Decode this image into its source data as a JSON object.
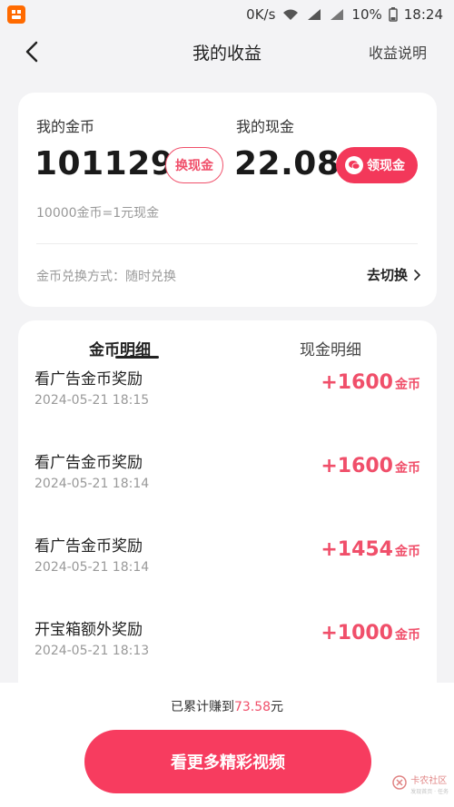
{
  "status_bar": {
    "speed": "0K/s",
    "signal_4g": "4G",
    "signal_3g": "3G",
    "battery": "10%",
    "time": "18:24"
  },
  "nav": {
    "title": "我的收益",
    "right_link": "收益说明"
  },
  "balance": {
    "coins_label": "我的金币",
    "coins_value": "101129",
    "exchange_button": "换现金",
    "cash_label": "我的现金",
    "cash_value": "22.08",
    "withdraw_button": "领现金",
    "rate_text": "10000金币=1元现金",
    "exchange_mode": "金币兑换方式：随时兑换",
    "switch_link": "去切换"
  },
  "tabs": [
    {
      "label": "金币明细"
    },
    {
      "label": "现金明细"
    }
  ],
  "records": [
    {
      "title": "看广告金币奖励",
      "time": "2024-05-21 18:15",
      "amount": "+1600",
      "unit": "金币"
    },
    {
      "title": "看广告金币奖励",
      "time": "2024-05-21 18:14",
      "amount": "+1600",
      "unit": "金币"
    },
    {
      "title": "看广告金币奖励",
      "time": "2024-05-21 18:14",
      "amount": "+1454",
      "unit": "金币"
    },
    {
      "title": "开宝箱额外奖励",
      "time": "2024-05-21 18:13",
      "amount": "+1000",
      "unit": "金币"
    }
  ],
  "footer": {
    "earned_prefix": "已累计赚到",
    "earned_value": "73.58",
    "earned_suffix": "元",
    "cta_label": "看更多精彩视频",
    "watermark": "卡农社区",
    "watermark_sub": "发现首页 · 任务"
  },
  "colors": {
    "accent": "#f04f6a",
    "cta": "#f73c5f",
    "background": "#f3f3f5"
  }
}
